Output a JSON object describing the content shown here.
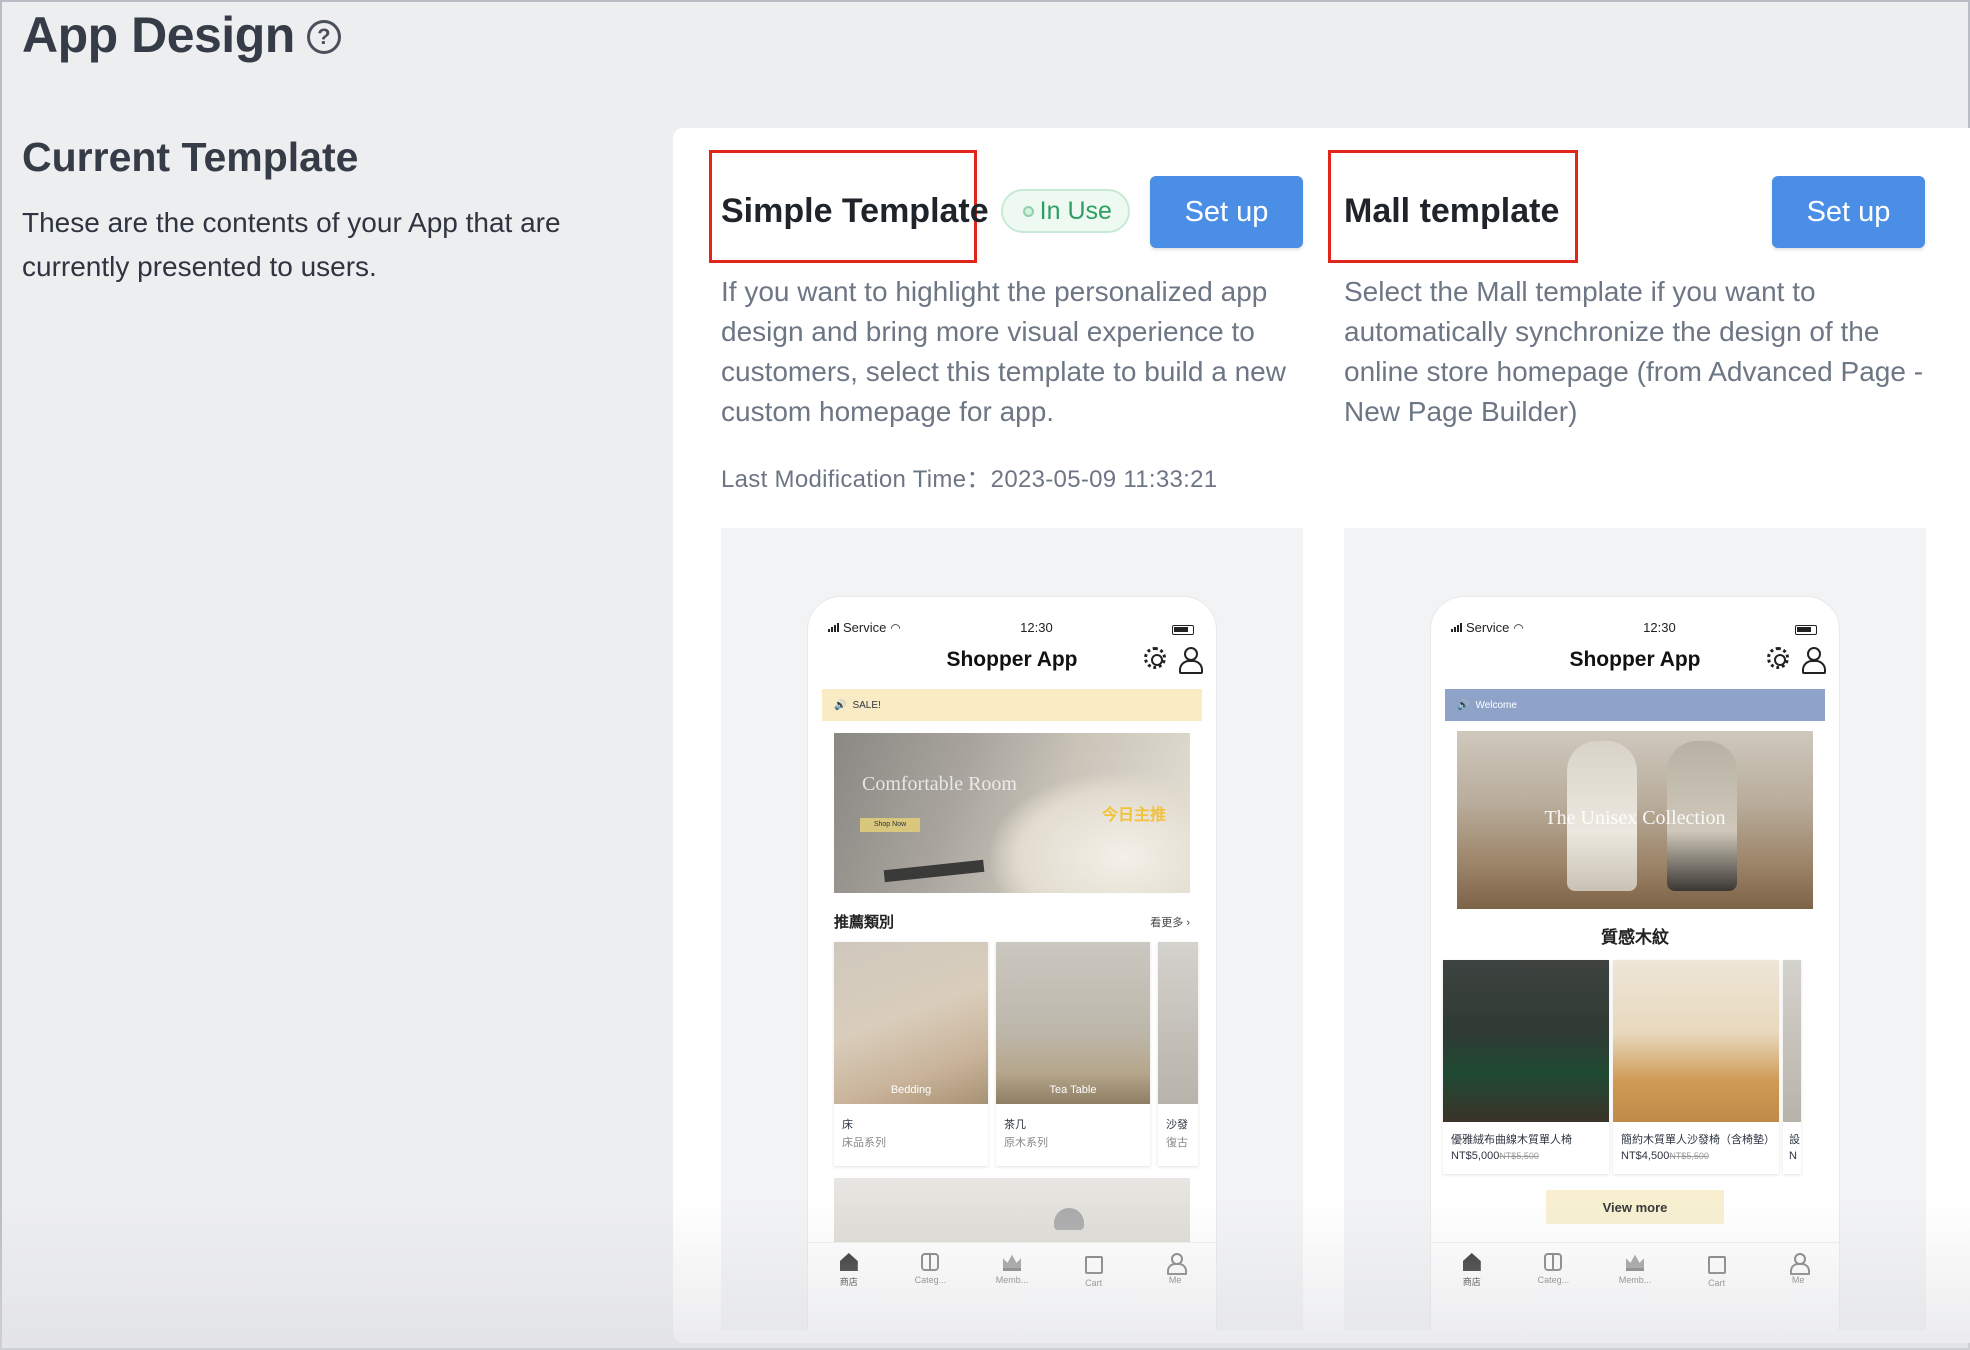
{
  "page": {
    "title": "App Design",
    "help_icon": "question-circle-icon"
  },
  "current_template": {
    "heading": "Current Template",
    "description": "These are the contents of your App that are currently presented to users."
  },
  "templates": [
    {
      "title": "Simple Template",
      "status_badge": "In Use",
      "setup_label": "Set up",
      "description": "If you want to highlight the personalized app design and bring more visual experience to customers, select this template to build a new custom homepage for app.",
      "modification_time": "Last Modification Time：2023-05-09 11:33:21",
      "preview": {
        "status_carrier": "Service",
        "status_time": "12:30",
        "app_name": "Shopper App",
        "announcement": "SALE!",
        "announcement_color": "#f9ecc4",
        "banner_title": "Comfortable Room",
        "banner_button": "Shop Now",
        "banner_tag": "今日主推",
        "section_title": "推薦類別",
        "section_more": "看更多",
        "categories": [
          {
            "image_label": "Bedding",
            "name": "床",
            "sub": "床品系列"
          },
          {
            "image_label": "Tea Table",
            "name": "茶几",
            "sub": "原木系列"
          },
          {
            "image_label": "",
            "name": "沙發",
            "sub": "復古"
          }
        ],
        "tabs": [
          {
            "label": "商店",
            "icon": "home-icon"
          },
          {
            "label": "Categ...",
            "icon": "category-icon"
          },
          {
            "label": "Memb...",
            "icon": "crown-icon"
          },
          {
            "label": "Cart",
            "icon": "bag-icon"
          },
          {
            "label": "Me",
            "icon": "person-icon"
          }
        ]
      }
    },
    {
      "title": "Mall template",
      "setup_label": "Set up",
      "description": "Select the Mall template if you want to automatically synchronize the design of the online store homepage (from Advanced Page - New Page Builder)",
      "preview": {
        "status_carrier": "Service",
        "status_time": "12:30",
        "app_name": "Shopper App",
        "announcement": "Welcome",
        "announcement_color": "#8fa3c9",
        "banner_title": "The Unisex Collection",
        "section_title": "質感木紋",
        "products": [
          {
            "name": "優雅絨布曲線木質單人椅",
            "price": "NT$5,000",
            "original_price": "NT$5,500"
          },
          {
            "name": "簡約木質單人沙發椅（含椅墊）",
            "price": "NT$4,500",
            "original_price": "NT$5,500"
          },
          {
            "name": "設",
            "price": "N",
            "original_price": ""
          }
        ],
        "view_more": "View more",
        "tabs": [
          {
            "label": "商店",
            "icon": "home-icon"
          },
          {
            "label": "Categ...",
            "icon": "category-icon"
          },
          {
            "label": "Memb...",
            "icon": "crown-icon"
          },
          {
            "label": "Cart",
            "icon": "bag-icon"
          },
          {
            "label": "Me",
            "icon": "person-icon"
          }
        ]
      }
    }
  ],
  "colors": {
    "primary_button": "#4a8ee6",
    "in_use_badge": "#2f9e63",
    "highlight_box": "#e0251b"
  }
}
